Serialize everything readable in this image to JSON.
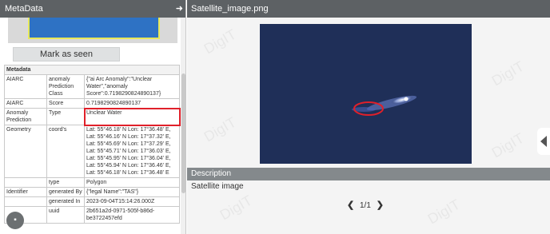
{
  "left_panel": {
    "title": "MetaData",
    "mark_button": "Mark as seen",
    "metadata_header": "Metadata",
    "rows": [
      {
        "col1": "AIARC",
        "col2": "anomaly Prediction Class",
        "col3": "{\"ai Arc Anomaly\":\"Unclear Water\",\"anomaly Score\":0.7198290824890137}"
      },
      {
        "col1": "AIARC",
        "col2": "Score",
        "col3": "0.7198290824890137"
      },
      {
        "col1": "Anomaly Prediction",
        "col2": "Type",
        "col3": "Unclear Water"
      },
      {
        "col1": "Geometry",
        "col2": "coord's",
        "col3_lines": [
          "Lat: 55°46.18' N Lon: 17°36.48' E,",
          "Lat: 55°46.16' N Lon: 17°37.32' E,",
          "Lat: 55°45.69' N Lon: 17°37.29' E,",
          "Lat: 55°45.71' N Lon: 17°36.03' E,",
          "Lat: 55°45.95' N Lon: 17°36.04' E,",
          "Lat: 55°45.94' N Lon: 17°36.46' E,",
          "Lat: 55°46.18' N Lon: 17°36.48' E"
        ]
      },
      {
        "col1": "",
        "col2": "type",
        "col3": "Polygon"
      },
      {
        "col1": "Identifier",
        "col2": "generated By",
        "col3": "{\"legal Name\":\"TAS\"}"
      },
      {
        "col1": "",
        "col2": "generated In",
        "col3": "2023-09-04T15:14:26.000Z"
      },
      {
        "col1": "",
        "col2": "uuid",
        "col3": "2b651a2d-0971-505f-b86d-be3722457efd"
      }
    ]
  },
  "right_panel": {
    "title": "Satellite_image.png",
    "description_header": "Description",
    "description_text": "Satellite image",
    "pager": "1/1"
  },
  "watermark": "DigIT",
  "colors": {
    "header": "#5d6164",
    "description_header": "#84898c",
    "highlight": "#e0202a",
    "sea": "#1f2f58"
  }
}
